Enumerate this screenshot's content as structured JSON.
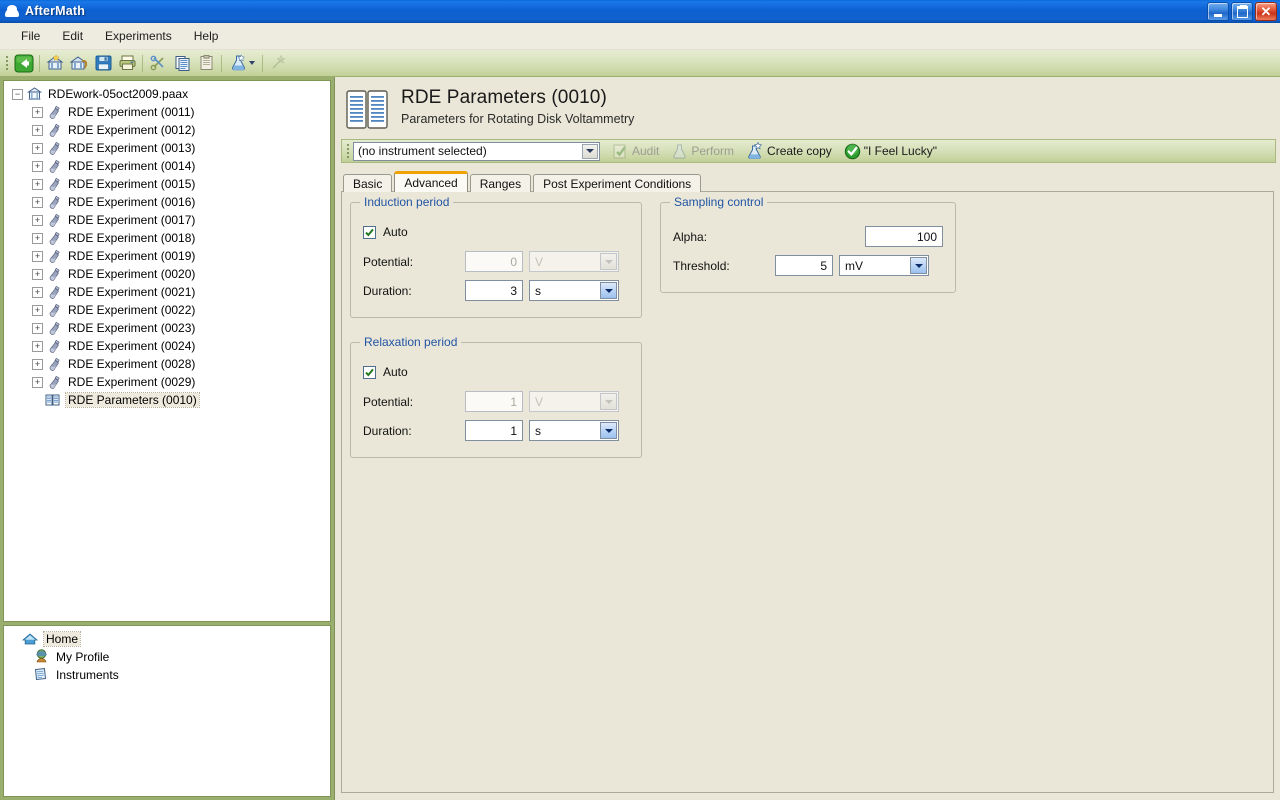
{
  "window": {
    "title": "AfterMath",
    "app_icon": "aftermath-dome-icon",
    "buttons": {
      "minimize": "minimize-icon",
      "restore": "restore-icon",
      "close": "close-icon"
    }
  },
  "menubar": {
    "items": [
      {
        "label": "File"
      },
      {
        "label": "Edit"
      },
      {
        "label": "Experiments"
      },
      {
        "label": "Help"
      }
    ]
  },
  "toolbar": {
    "buttons": [
      {
        "name": "back-button",
        "icon": "green-back-arrow-icon",
        "enabled": true
      },
      {
        "name": "new-archive-button",
        "icon": "archive-new-icon",
        "enabled": true
      },
      {
        "name": "open-archive-button",
        "icon": "archive-open-icon",
        "enabled": true
      },
      {
        "name": "save-button",
        "icon": "floppy-save-icon",
        "enabled": true
      },
      {
        "name": "print-button",
        "icon": "printer-icon",
        "enabled": true
      },
      {
        "name": "cut-button",
        "icon": "scissors-icon",
        "enabled": true
      },
      {
        "name": "copy-button",
        "icon": "copy-pages-icon",
        "enabled": true
      },
      {
        "name": "paste-button",
        "icon": "clipboard-paste-icon",
        "enabled": true
      },
      {
        "name": "new-experiment-button",
        "icon": "flask-star-icon",
        "enabled": true
      },
      {
        "name": "perform-button",
        "icon": "star-wand-icon",
        "enabled": false
      }
    ]
  },
  "tree": {
    "root": {
      "label": "RDEwork-05oct2009.paax",
      "icon": "archive-icon",
      "expanded": true
    },
    "items": [
      {
        "label": "RDE Experiment (0011)",
        "icon": "flask-icon",
        "expandable": true
      },
      {
        "label": "RDE Experiment (0012)",
        "icon": "flask-icon",
        "expandable": true
      },
      {
        "label": "RDE Experiment (0013)",
        "icon": "flask-icon",
        "expandable": true
      },
      {
        "label": "RDE Experiment (0014)",
        "icon": "flask-icon",
        "expandable": true
      },
      {
        "label": "RDE Experiment (0015)",
        "icon": "flask-icon",
        "expandable": true
      },
      {
        "label": "RDE Experiment (0016)",
        "icon": "flask-icon",
        "expandable": true
      },
      {
        "label": "RDE Experiment (0017)",
        "icon": "flask-icon",
        "expandable": true
      },
      {
        "label": "RDE Experiment (0018)",
        "icon": "flask-icon",
        "expandable": true
      },
      {
        "label": "RDE Experiment (0019)",
        "icon": "flask-icon",
        "expandable": true
      },
      {
        "label": "RDE Experiment (0020)",
        "icon": "flask-icon",
        "expandable": true
      },
      {
        "label": "RDE Experiment (0021)",
        "icon": "flask-icon",
        "expandable": true
      },
      {
        "label": "RDE Experiment (0022)",
        "icon": "flask-icon",
        "expandable": true
      },
      {
        "label": "RDE Experiment (0023)",
        "icon": "flask-icon",
        "expandable": true
      },
      {
        "label": "RDE Experiment (0024)",
        "icon": "flask-icon",
        "expandable": true
      },
      {
        "label": "RDE Experiment (0028)",
        "icon": "flask-icon",
        "expandable": true
      },
      {
        "label": "RDE Experiment (0029)",
        "icon": "flask-icon",
        "expandable": true
      },
      {
        "label": "RDE Parameters (0010)",
        "icon": "book-icon",
        "expandable": false,
        "selected": true
      }
    ]
  },
  "navtree": {
    "items": [
      {
        "label": "Home",
        "icon": "home-icon",
        "selected": true
      },
      {
        "label": "My Profile",
        "icon": "profile-icon",
        "selected": false
      },
      {
        "label": "Instruments",
        "icon": "instruments-icon",
        "selected": false
      }
    ]
  },
  "document": {
    "icon": "open-book-pages-icon",
    "title": "RDE Parameters (0010)",
    "subtitle": "Parameters for Rotating Disk Voltammetry"
  },
  "actionbar": {
    "instrument_combo": {
      "value": "(no instrument selected)",
      "placeholder": "(no instrument selected)"
    },
    "actions": [
      {
        "name": "audit-button",
        "label": "Audit",
        "icon": "audit-check-icon",
        "enabled": false
      },
      {
        "name": "perform-button",
        "label": "Perform",
        "icon": "flask-perform-icon",
        "enabled": false
      },
      {
        "name": "create-copy-button",
        "label": "Create copy",
        "icon": "flask-copy-icon",
        "enabled": true
      },
      {
        "name": "i-feel-lucky-button",
        "label": "\"I Feel Lucky\"",
        "icon": "green-check-circle-icon",
        "enabled": true
      }
    ]
  },
  "tabs": {
    "items": [
      {
        "label": "Basic",
        "active": false
      },
      {
        "label": "Advanced",
        "active": true
      },
      {
        "label": "Ranges",
        "active": false
      },
      {
        "label": "Post Experiment Conditions",
        "active": false
      }
    ],
    "active_accent": "#f0a300"
  },
  "advanced": {
    "induction": {
      "title": "Induction period",
      "auto": {
        "label": "Auto",
        "checked": true
      },
      "potential": {
        "label": "Potential:",
        "value": "0",
        "unit": "V",
        "enabled": false
      },
      "duration": {
        "label": "Duration:",
        "value": "3",
        "unit": "s",
        "enabled": true
      }
    },
    "relaxation": {
      "title": "Relaxation period",
      "auto": {
        "label": "Auto",
        "checked": true
      },
      "potential": {
        "label": "Potential:",
        "value": "1",
        "unit": "V",
        "enabled": false
      },
      "duration": {
        "label": "Duration:",
        "value": "1",
        "unit": "s",
        "enabled": true
      }
    },
    "sampling": {
      "title": "Sampling control",
      "alpha": {
        "label": "Alpha:",
        "value": "100",
        "enabled": true
      },
      "threshold": {
        "label": "Threshold:",
        "value": "5",
        "unit": "mV",
        "enabled": true
      }
    }
  },
  "colors": {
    "titlebar_blue": "#0d5fd0",
    "toolbar_green": "#cdd9a9",
    "panel_bg": "#eae7d8",
    "group_title_blue": "#2255a4",
    "tab_accent_orange": "#f0a300",
    "splitter_green": "#9aae6e"
  }
}
